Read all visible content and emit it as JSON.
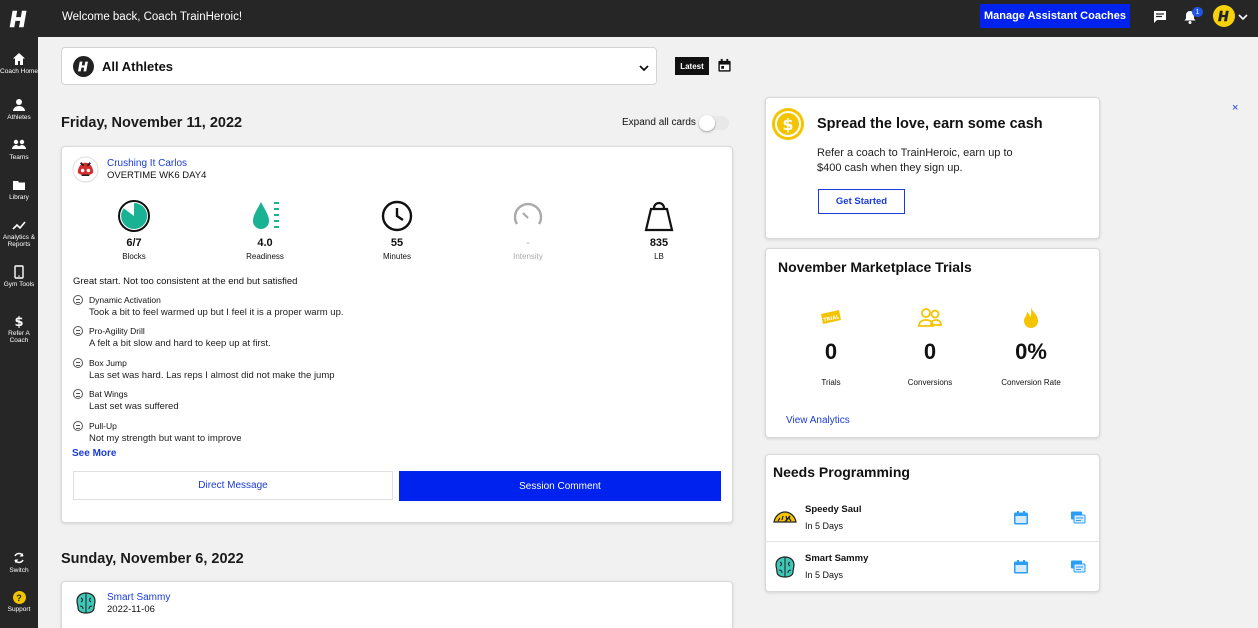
{
  "header": {
    "welcome": "Welcome back, Coach TrainHeroic!",
    "manage_button": "Manage Assistant Coaches",
    "notification_count": "1"
  },
  "sidebar": {
    "items": [
      {
        "label": "Coach Home",
        "icon": "home-icon"
      },
      {
        "label": "Athletes",
        "icon": "person-icon"
      },
      {
        "label": "Teams",
        "icon": "teams-icon"
      },
      {
        "label": "Library",
        "icon": "folder-icon"
      },
      {
        "label": "Analytics & Reports",
        "icon": "trend-icon"
      },
      {
        "label": "Gym Tools",
        "icon": "tablet-icon"
      },
      {
        "label": "Refer A Coach",
        "icon": "dollar-icon"
      }
    ],
    "bottom": [
      {
        "label": "Switch",
        "icon": "switch-icon"
      },
      {
        "label": "Support",
        "icon": "help-icon"
      }
    ]
  },
  "filter": {
    "selected": "All Athletes",
    "latest_button": "Latest"
  },
  "feed": {
    "expand_label": "Expand all cards",
    "days": [
      {
        "date": "Friday, November 11, 2022",
        "athlete": "Crushing It Carlos",
        "workout": "OVERTIME WK6 DAY4",
        "metrics": [
          {
            "value": "6/7",
            "label": "Blocks"
          },
          {
            "value": "4.0",
            "label": "Readiness"
          },
          {
            "value": "55",
            "label": "Minutes"
          },
          {
            "value": "-",
            "label": "Intensity"
          },
          {
            "value": "835",
            "label": "LB"
          }
        ],
        "summary": "Great start. Not too consistent at the end but satisfied",
        "exercises": [
          {
            "name": "Dynamic Activation",
            "comment": "Took a bit to feel warmed up but I feel it is a proper warm up."
          },
          {
            "name": "Pro-Agility Drill",
            "comment": "A felt a bit slow and hard to keep up at first."
          },
          {
            "name": "Box Jump",
            "comment": "Las set was hard. Las reps I almost did not make the jump"
          },
          {
            "name": "Bat Wings",
            "comment": "Last set was suffered"
          },
          {
            "name": "Pull-Up",
            "comment": "Not my strength but want to improve"
          }
        ],
        "see_more": "See More",
        "direct_message": "Direct Message",
        "session_comment": "Session Comment"
      },
      {
        "date": "Sunday, November 6, 2022",
        "athlete": "Smart Sammy",
        "workout": "2022-11-06"
      }
    ]
  },
  "promo": {
    "title": "Spread the love, earn some cash",
    "text": "Refer a coach to TrainHeroic, earn up to $400 cash when they sign up.",
    "button": "Get Started",
    "close": "×"
  },
  "marketplace": {
    "title": "November Marketplace Trials",
    "stats": [
      {
        "value": "0",
        "label": "Trials",
        "icon": "trial-tag-icon"
      },
      {
        "value": "0",
        "label": "Conversions",
        "icon": "people-icon"
      },
      {
        "value": "0%",
        "label": "Conversion Rate",
        "icon": "fire-icon"
      }
    ],
    "link": "View Analytics"
  },
  "needs_programming": {
    "title": "Needs Programming",
    "athletes": [
      {
        "name": "Speedy Saul",
        "due": "In 5 Days"
      },
      {
        "name": "Smart Sammy",
        "due": "In 5 Days"
      }
    ]
  },
  "colors": {
    "primary_blue": "#0022ee",
    "link_blue": "#1a3bd6",
    "accent_yellow": "#f7d20c",
    "sidebar_dark": "#262626",
    "readiness_green": "#16a085"
  }
}
